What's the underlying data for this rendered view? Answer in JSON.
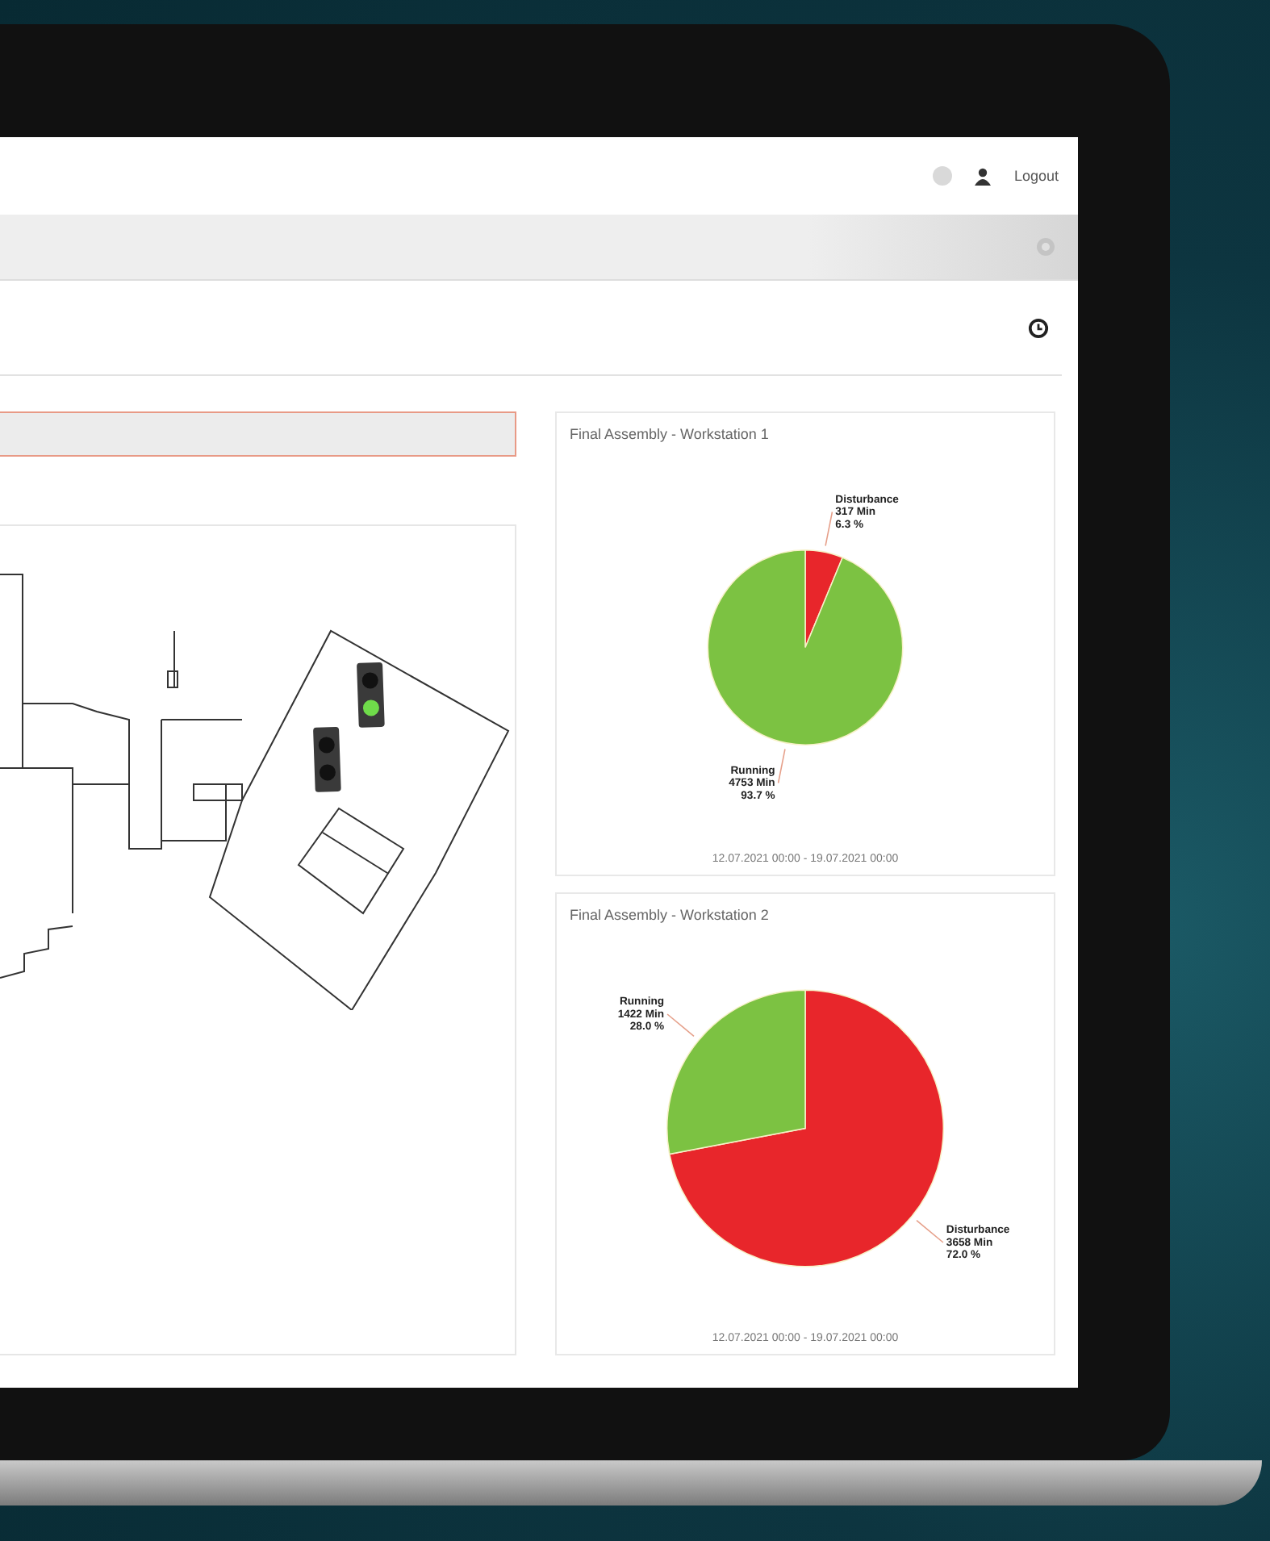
{
  "header": {
    "logout": "Logout"
  },
  "floor_map": {
    "traffic_lights": [
      {
        "green_on": true
      },
      {
        "green_on": false
      }
    ]
  },
  "charts": [
    {
      "title": "Final Assembly - Workstation 1",
      "range": "12.07.2021 00:00 - 19.07.2021 00:00",
      "chart_data": {
        "type": "pie",
        "categories": [
          "Disturbance",
          "Running"
        ],
        "colors": [
          "#e8262b",
          "#7cc242"
        ],
        "values": [
          317,
          4753
        ],
        "value_labels": [
          "317 Min\n6.3 %",
          "4753 Min\n93.7 %"
        ],
        "data_labels": true
      }
    },
    {
      "title": "Final Assembly - Workstation 2",
      "range": "12.07.2021 00:00 - 19.07.2021 00:00",
      "chart_data": {
        "type": "pie",
        "categories": [
          "Disturbance",
          "Running"
        ],
        "colors": [
          "#e8262b",
          "#7cc242"
        ],
        "values": [
          3658,
          1422
        ],
        "value_labels": [
          "3658 Min\n72.0 %",
          "1422 Min\n28.0 %"
        ],
        "data_labels": true
      }
    }
  ]
}
